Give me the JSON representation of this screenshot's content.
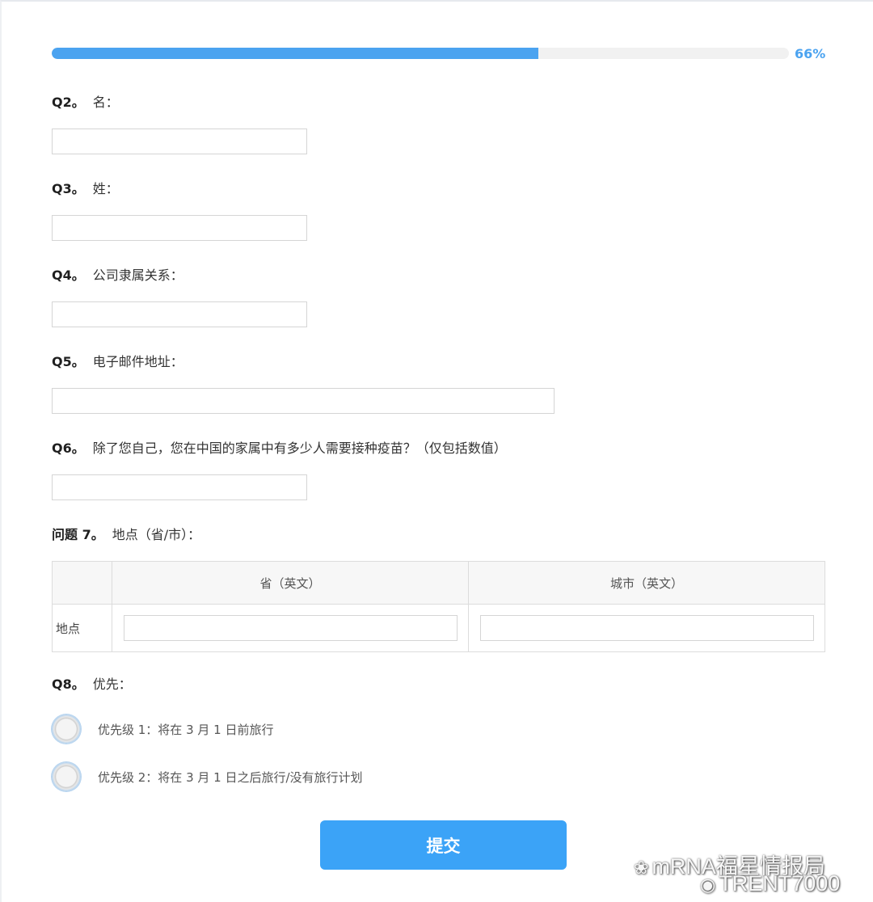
{
  "progress": {
    "value": 0.66,
    "label": "66%"
  },
  "questions": [
    {
      "num": "Q2。",
      "text": "名："
    },
    {
      "num": "Q3。",
      "text": "姓："
    },
    {
      "num": "Q4。",
      "text": "公司隶属关系："
    },
    {
      "num": "Q5。",
      "text": "电子邮件地址："
    },
    {
      "num": "Q6。",
      "text": "除了您自己，您在中国的家属中有多少人需要接种疫苗？（仅包括数值）"
    },
    {
      "num": "问题 7。",
      "text": "地点（省/市）："
    },
    {
      "num": "Q8。",
      "text": "优先："
    }
  ],
  "location_table": {
    "headers": [
      "",
      "省（英文）",
      "城市（英文）"
    ],
    "row_label": "地点"
  },
  "radio_options": [
    "优先级 1：将在 3 月 1 日前旅行",
    "优先级 2：将在 3 月 1 日之后旅行/没有旅行计划"
  ],
  "submit_label": "提交",
  "watermark": {
    "line1": "mRNA福星情报局",
    "line2": "TRENT7000"
  },
  "colors": {
    "accent": "#4ba3f0",
    "button": "#3ba3f7"
  }
}
